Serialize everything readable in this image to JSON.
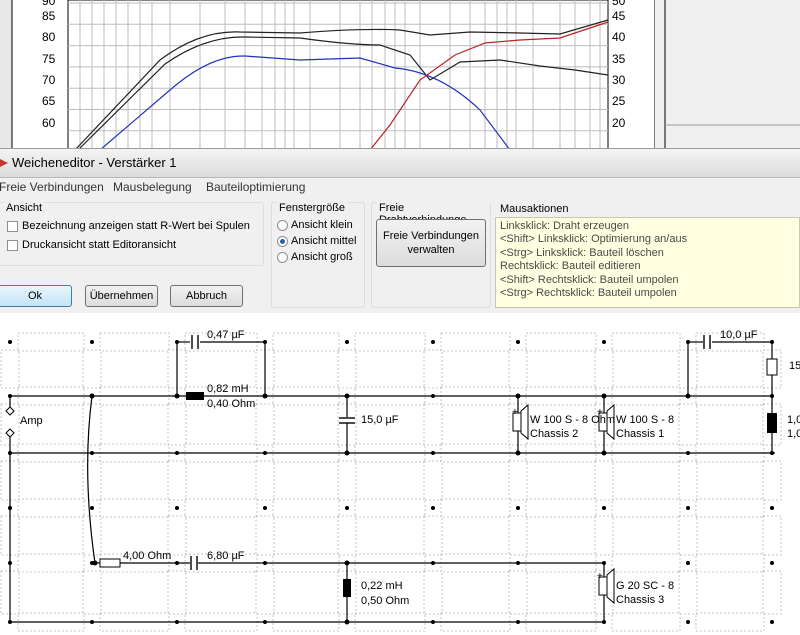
{
  "background_chart": {
    "left_ticks": [
      "85",
      "80",
      "75",
      "70",
      "65",
      "60"
    ],
    "right_ticks": [
      "45",
      "40",
      "35",
      "30",
      "25",
      "20"
    ],
    "top_left_tick": "90",
    "top_right_tick": "50"
  },
  "window": {
    "title": "Weicheneditor - Verstärker 1"
  },
  "menu": {
    "items": [
      "Freie Verbindungen",
      "Mausbelegung",
      "Bauteiloptimierung"
    ]
  },
  "ansicht": {
    "group_label": "Ansicht",
    "checkbox1": "Bezeichnung anzeigen statt R-Wert bei Spulen",
    "checkbox2": "Druckansicht statt Editoransicht"
  },
  "fenstergroesse": {
    "group_label": "Fenstergröße",
    "options": [
      "Ansicht klein",
      "Ansicht mittel",
      "Ansicht groß"
    ],
    "selected": "Ansicht mittel"
  },
  "drahtverbindungen": {
    "group_label": "Freie Drahtverbindunge",
    "button_line1": "Freie Verbindungen",
    "button_line2": "verwalten"
  },
  "mausaktionen": {
    "group_label": "Mausaktionen",
    "lines": [
      "Linksklick: Draht erzeugen",
      "<Shift> Linksklick: Optimierung an/aus",
      "<Strg> Linksklick: Bauteil löschen",
      "Rechtsklick: Bauteil editieren",
      "<Shift> Rechtsklick: Bauteil umpolen",
      "<Strg> Rechtsklick: Bauteil umpolen"
    ]
  },
  "buttons": {
    "ok": "Ok",
    "apply": "Übernehmen",
    "cancel": "Abbruch"
  },
  "schematic": {
    "amp_label": "Amp",
    "cap1": "0,47 µF",
    "coil1_l": "0,82 mH",
    "coil1_r": "0,40 Ohm",
    "cap2": "15,0 µF",
    "driver1_name": "W 100 S - 8 Ohm",
    "driver1_chassis": "Chassis 2",
    "driver2_name": "W 100 S - 8",
    "driver2_chassis": "Chassis 1",
    "cap3": "10,0 µF",
    "res_right": "15,",
    "right_val1": "1,0",
    "right_val2": "1,0",
    "res1": "4,00 Ohm",
    "cap4": "6,80 µF",
    "coil2_l": "0,22 mH",
    "coil2_r": "0,50 Ohm",
    "driver3_name": "G 20 SC - 8",
    "driver3_chassis": "Chassis 3"
  },
  "colors": {
    "titlebar_icon": "#c0392b",
    "accent_radio": "#2c5fa9",
    "mouse_info_bg": "#ffffe1"
  }
}
